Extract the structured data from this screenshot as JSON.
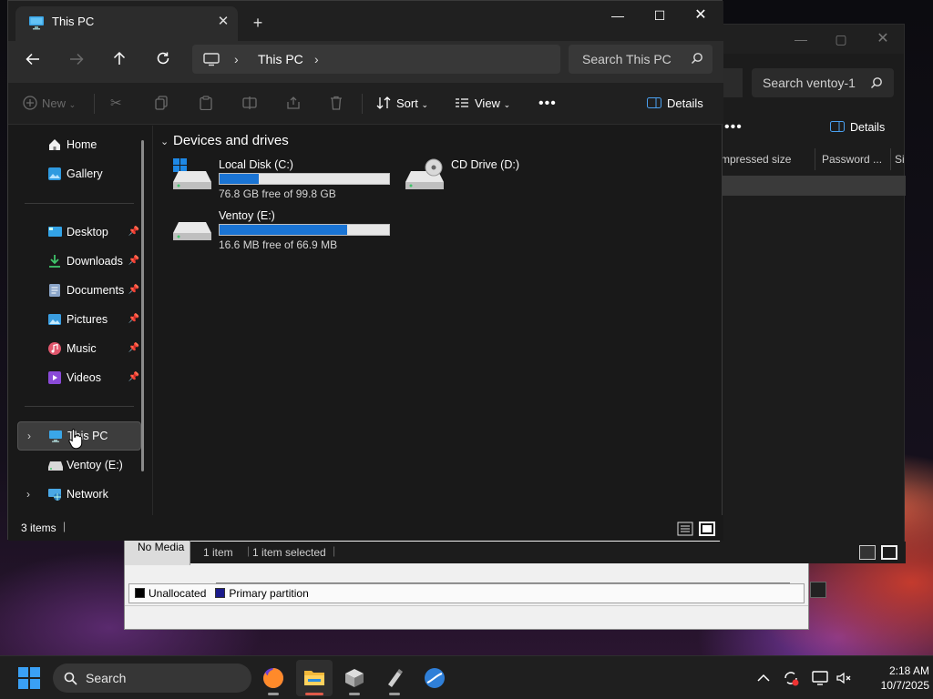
{
  "bg_window": {
    "search_placeholder": "Search ventoy-1",
    "details_label": "Details",
    "columns": [
      "mpressed size",
      "Password ...",
      "Si"
    ]
  },
  "disk_mgmt": {
    "no_media": "No Media",
    "legend_unallocated": "Unallocated",
    "legend_primary": "Primary partition",
    "status_items": "1 item",
    "status_selected": "1 item selected"
  },
  "explorer": {
    "tab_title": "This PC",
    "breadcrumb": [
      "This PC"
    ],
    "search_placeholder": "Search This PC",
    "toolbar": {
      "new_label": "New",
      "sort_label": "Sort",
      "view_label": "View",
      "details_label": "Details"
    },
    "sidebar": {
      "items": [
        {
          "label": "Home",
          "icon": "home-icon"
        },
        {
          "label": "Gallery",
          "icon": "gallery-icon"
        },
        {
          "label": "Desktop",
          "icon": "desktop-icon"
        },
        {
          "label": "Downloads",
          "icon": "downloads-icon"
        },
        {
          "label": "Documents",
          "icon": "documents-icon"
        },
        {
          "label": "Pictures",
          "icon": "pictures-icon"
        },
        {
          "label": "Music",
          "icon": "music-icon"
        },
        {
          "label": "Videos",
          "icon": "videos-icon"
        },
        {
          "label": "This PC",
          "icon": "pc-icon"
        },
        {
          "label": "Ventoy (E:)",
          "icon": "drive-icon"
        },
        {
          "label": "Network",
          "icon": "network-icon"
        }
      ]
    },
    "group_header": "Devices and drives",
    "drives": [
      {
        "name": "Local Disk (C:)",
        "free": "76.8 GB free of 99.8 GB",
        "used_fraction": 0.23
      },
      {
        "name": "CD Drive (D:)"
      },
      {
        "name": "Ventoy (E:)",
        "free": "16.6 MB free of 66.9 MB",
        "used_fraction": 0.75
      }
    ],
    "status_text": "3 items"
  },
  "taskbar": {
    "search_placeholder": "Search",
    "time": "2:18 AM",
    "date": "10/7/2025"
  },
  "colors": {
    "accent": "#1a74d4",
    "window_bg": "#191919"
  }
}
